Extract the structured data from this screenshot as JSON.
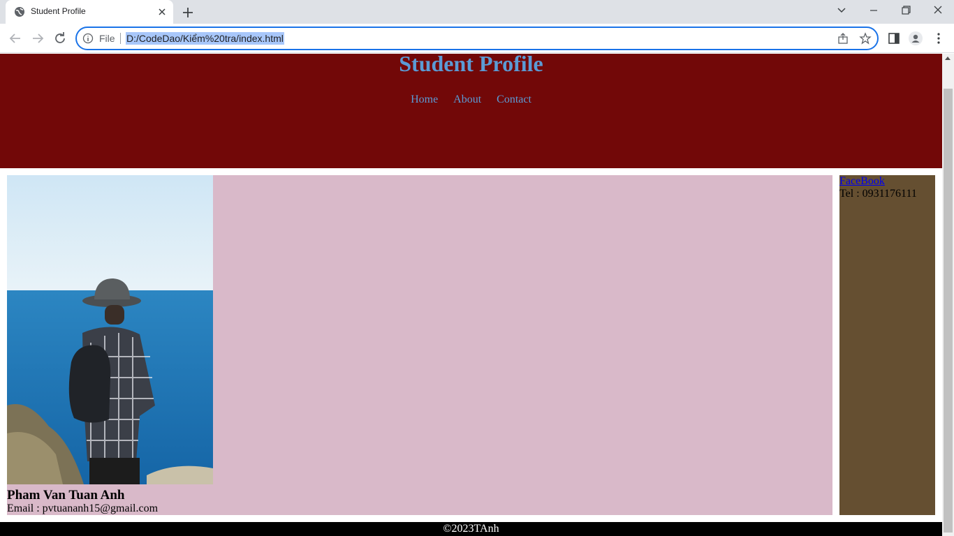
{
  "browser": {
    "tab_title": "Student Profile",
    "scheme_label": "File",
    "url": "D:/CodeDao/Kiểm%20tra/index.html"
  },
  "site": {
    "title": "Student Profile",
    "nav": [
      "Home",
      "About",
      "Contact"
    ]
  },
  "profile": {
    "name": "Pham Van Tuan Anh",
    "email": "Email : pvtuananh15@gmail.com"
  },
  "sidebar": {
    "facebook_link": "FaceBook",
    "tel": "Tel : 0931176111"
  },
  "footer": {
    "copyright": "©2023TAnh"
  },
  "colors": {
    "header_bg": "#720808",
    "title_color": "#5b9bd5",
    "main_bg": "#d9b9c9",
    "sidebar_bg": "#654f31",
    "footer_bg": "#000000"
  }
}
